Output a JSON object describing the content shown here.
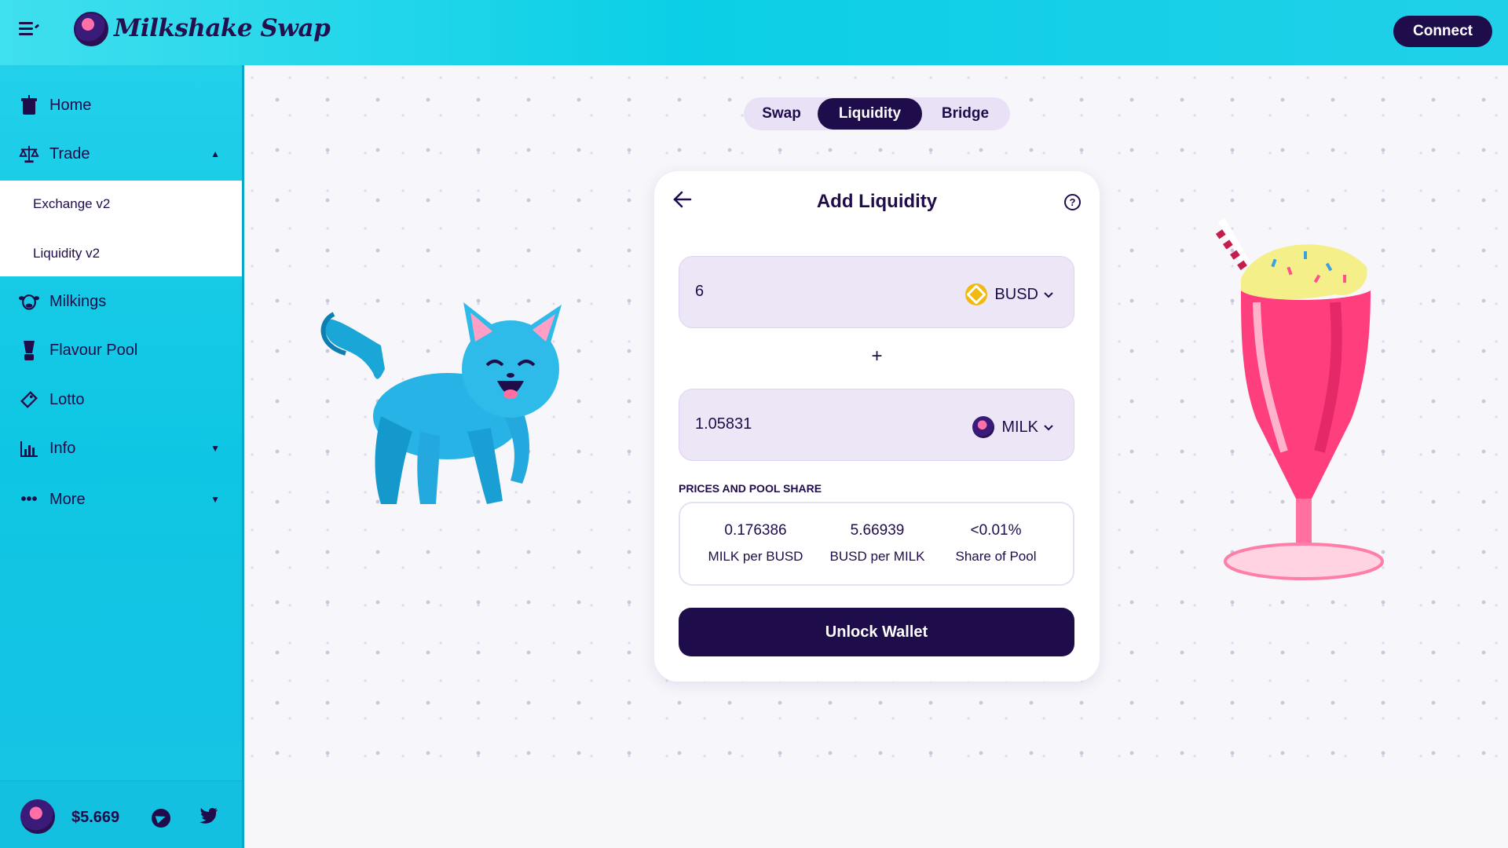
{
  "header": {
    "app_name": "Milkshake Swap",
    "connect_label": "Connect"
  },
  "sidebar": {
    "items": [
      {
        "label": "Home",
        "icon": "cup-icon"
      },
      {
        "label": "Trade",
        "icon": "scale-icon"
      },
      {
        "label": "Milkings",
        "icon": "cow-icon"
      },
      {
        "label": "Flavour Pool",
        "icon": "blender-icon"
      },
      {
        "label": "Lotto",
        "icon": "ticket-icon"
      },
      {
        "label": "Info",
        "icon": "bar-chart-icon"
      },
      {
        "label": "More",
        "icon": "more-icon"
      }
    ],
    "trade_submenu": [
      "Exchange v2",
      "Liquidity v2"
    ],
    "footer": {
      "price": "$5.669"
    }
  },
  "tabs": [
    "Swap",
    "Liquidity",
    "Bridge"
  ],
  "active_tab": "Liquidity",
  "card": {
    "title": "Add Liquidity",
    "input_a": {
      "value": "6",
      "token": "BUSD"
    },
    "plus": "+",
    "input_b": {
      "value": "1.05831",
      "token": "MILK"
    },
    "prices_label": "PRICES AND POOL SHARE",
    "prices": [
      {
        "value": "0.176386",
        "label": "MILK per BUSD"
      },
      {
        "value": "5.66939",
        "label": "BUSD per MILK"
      },
      {
        "value": "<0.01%",
        "label": "Share of Pool"
      }
    ],
    "unlock_label": "Unlock Wallet"
  },
  "colors": {
    "primary": "#1f0c4a",
    "accent": "#0ecfe6",
    "input_bg": "#ece6f7",
    "busd": "#f2b90f"
  }
}
